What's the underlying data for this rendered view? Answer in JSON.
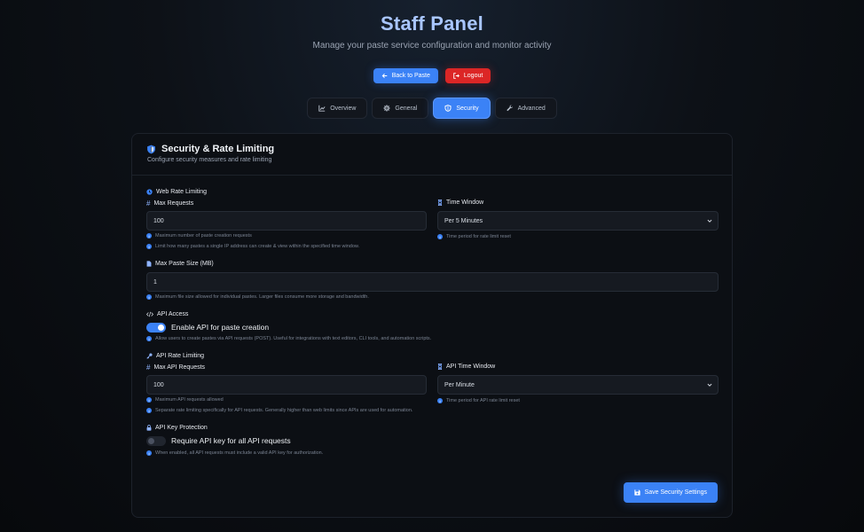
{
  "header": {
    "title": "Staff Panel",
    "subtitle": "Manage your paste service configuration and monitor activity"
  },
  "actions": {
    "back_label": "Back to Paste",
    "logout_label": "Logout"
  },
  "tabs": [
    {
      "label": "Overview",
      "icon": "chart-line-icon",
      "active": false
    },
    {
      "label": "General",
      "icon": "gear-icon",
      "active": false
    },
    {
      "label": "Security",
      "icon": "shield-icon",
      "active": true
    },
    {
      "label": "Advanced",
      "icon": "wrench-icon",
      "active": false
    }
  ],
  "card": {
    "title": "Security & Rate Limiting",
    "subtitle": "Configure security measures and rate limiting"
  },
  "web_rate": {
    "section": "Web Rate Limiting",
    "max_requests_label": "Max Requests",
    "max_requests_value": "100",
    "max_requests_hint": "Maximum number of paste creation requests",
    "section_hint": "Limit how many pastes a single IP address can create & view within the specified time window.",
    "time_window_label": "Time Window",
    "time_window_value": "Per 5 Minutes",
    "time_window_hint": "Time period for rate limit reset"
  },
  "paste_size": {
    "label": "Max Paste Size (MB)",
    "value": "1",
    "hint": "Maximum file size allowed for individual pastes. Larger files consume more storage and bandwidth."
  },
  "api_access": {
    "section": "API Access",
    "toggle_label": "Enable API for paste creation",
    "enabled": true,
    "hint": "Allow users to create pastes via API requests (POST). Useful for integrations with text editors, CLI tools, and automation scripts."
  },
  "api_rate": {
    "section": "API Rate Limiting",
    "max_label": "Max API Requests",
    "max_value": "100",
    "max_hint": "Maximum API requests allowed",
    "section_hint": "Separate rate limiting specifically for API requests. Generally higher than web limits since APIs are used for automation.",
    "window_label": "API Time Window",
    "window_value": "Per Minute",
    "window_hint": "Time period for API rate limit reset"
  },
  "api_key": {
    "section": "API Key Protection",
    "toggle_label": "Require API key for all API requests",
    "enabled": false,
    "hint": "When enabled, all API requests must include a valid API key for authorization."
  },
  "save_label": "Save Security Settings",
  "colors": {
    "accent": "#3b82f6",
    "danger": "#dc2626",
    "title": "#a9c6ff",
    "background": "#0d1117"
  }
}
